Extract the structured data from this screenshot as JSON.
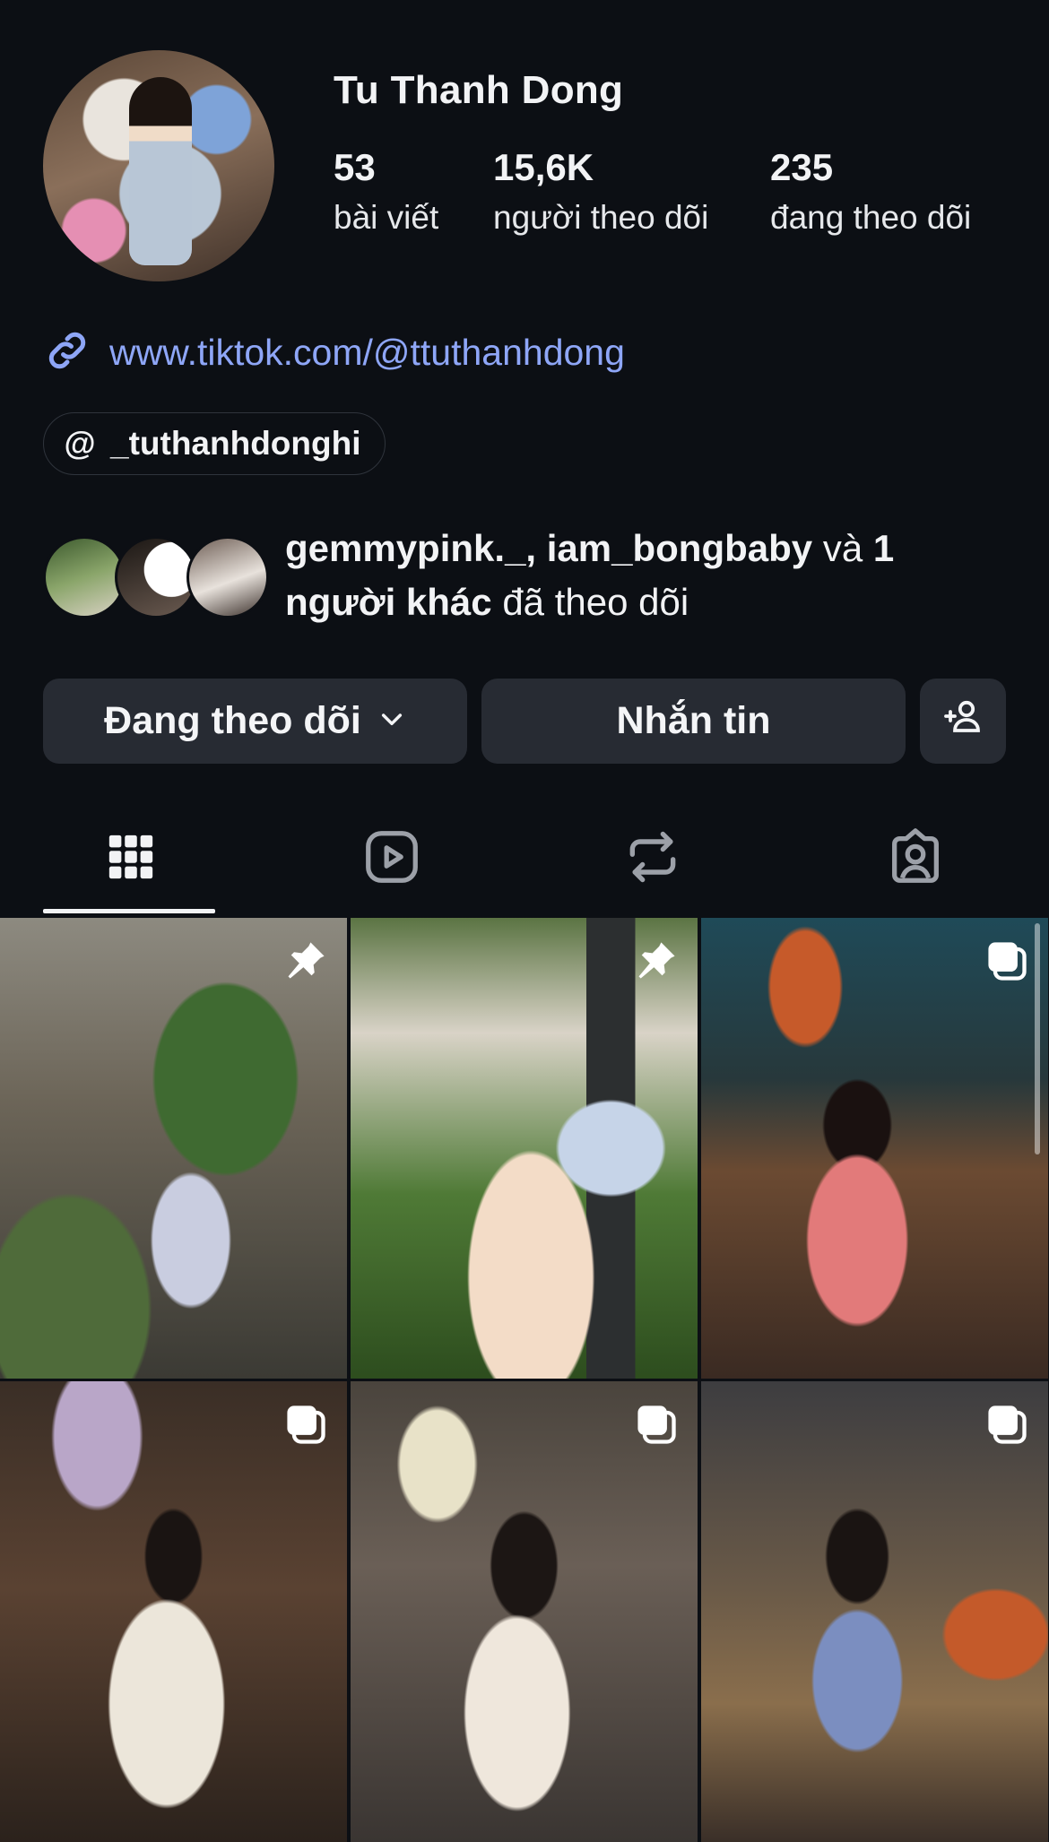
{
  "profile": {
    "name": "Tu Thanh Dong",
    "stats": [
      {
        "num": "53",
        "label": "bài viết"
      },
      {
        "num": "15,6K",
        "label": "người theo dõi"
      },
      {
        "num": "235",
        "label": "đang theo dõi"
      }
    ],
    "link": "www.tiktok.com/@ttuthanhdong",
    "threads_handle": "_tuthanhdonghi",
    "threads_glyph": "@"
  },
  "mutual": {
    "names": "gemmypink._, iam_bongbaby",
    "conj": " và ",
    "others": "1 người khác",
    "suffix": " đã theo dõi"
  },
  "actions": {
    "follow_label": "Đang theo dõi",
    "message_label": "Nhắn tin"
  },
  "tabs": [
    "posts-grid",
    "reels",
    "reposts",
    "tagged"
  ],
  "posts": [
    {
      "badge": "pin-icon"
    },
    {
      "badge": "pin-icon"
    },
    {
      "badge": "carousel-icon"
    },
    {
      "badge": "carousel-icon"
    },
    {
      "badge": "carousel-icon"
    },
    {
      "badge": "carousel-icon"
    }
  ],
  "colors": {
    "background": "#0c0f14",
    "link": "#8ea6f7",
    "button": "#272b33"
  }
}
